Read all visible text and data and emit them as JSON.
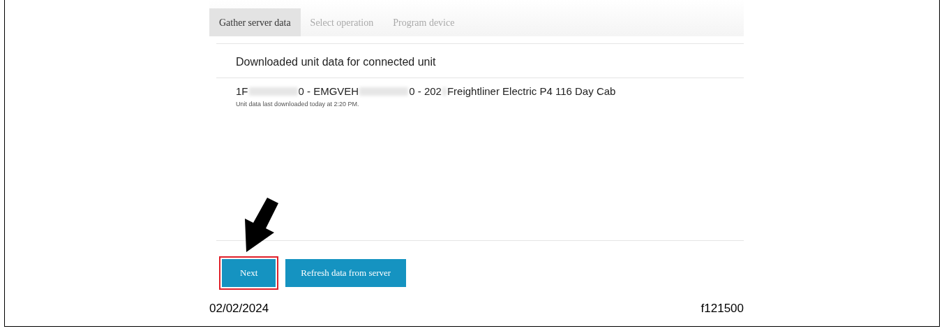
{
  "tabs": [
    {
      "label": "Gather server data",
      "selected": true
    },
    {
      "label": "Select operation",
      "selected": false
    },
    {
      "label": "Program device",
      "selected": false
    }
  ],
  "section_title": "Downloaded unit data for connected unit",
  "unit": {
    "segments": [
      "1F",
      "0 - EMGVEH",
      "0 - 202",
      "Freightliner Electric P4 116 Day Cab"
    ],
    "note": "Unit data last downloaded today at 2:20 PM."
  },
  "buttons": [
    {
      "label": "Next",
      "highlighted": true
    },
    {
      "label": "Refresh data from server",
      "highlighted": false
    }
  ],
  "footer": {
    "date": "02/02/2024",
    "figure_id": "f121500"
  }
}
